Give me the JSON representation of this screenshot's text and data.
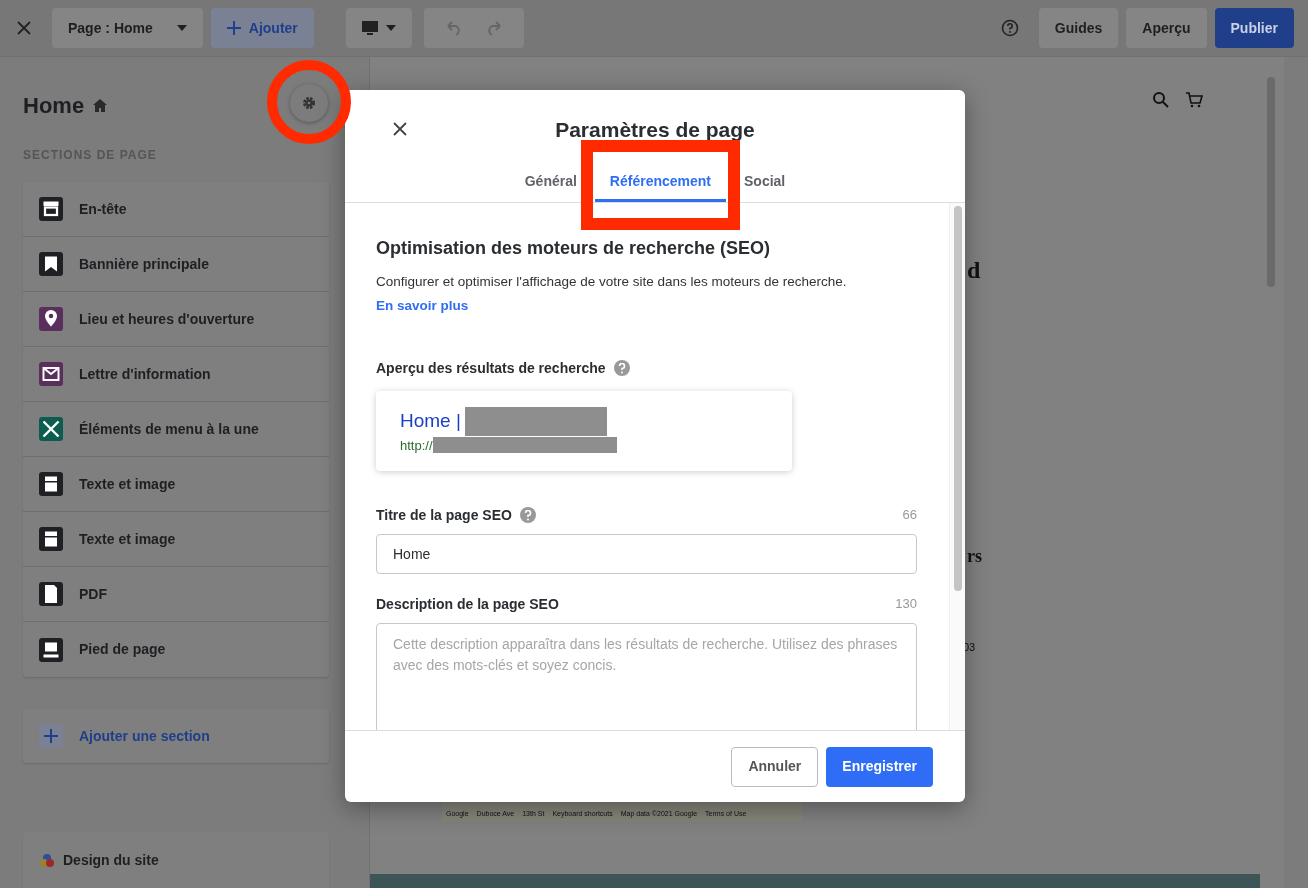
{
  "topbar": {
    "page_select": "Page : Home",
    "add": "Ajouter",
    "buttons": [
      {
        "label": "Guides",
        "kind": "plain"
      },
      {
        "label": "Aperçu",
        "kind": "plain"
      },
      {
        "label": "Publier",
        "kind": "primary"
      }
    ]
  },
  "sidebar": {
    "title": "Home",
    "heading": "SECTIONS DE PAGE",
    "sections": [
      {
        "label": "En-tête",
        "kind": "header",
        "color": "#1e2024"
      },
      {
        "label": "Bannière principale",
        "kind": "banner",
        "color": "#1e2024"
      },
      {
        "label": "Lieu et heures d'ouverture",
        "kind": "location",
        "color": "#5b2f5b"
      },
      {
        "label": "Lettre d'information",
        "kind": "mail",
        "color": "#5b2f5b"
      },
      {
        "label": "Éléments de menu à la une",
        "kind": "menu",
        "color": "#0c5d4f"
      },
      {
        "label": "Texte et image",
        "kind": "block",
        "color": "#1e2024"
      },
      {
        "label": "Texte et image",
        "kind": "block",
        "color": "#1e2024"
      },
      {
        "label": "PDF",
        "kind": "pdf",
        "color": "#1e2024"
      },
      {
        "label": "Pied de page",
        "kind": "footer",
        "color": "#1e2024"
      }
    ],
    "add_section": "Ajouter une section",
    "design": "Design du site"
  },
  "preview": {
    "fragments": [
      "d",
      "rs",
      "03"
    ],
    "map_texts": [
      "Google",
      "Duboce Ave",
      "13th St",
      "Keyboard shortcuts",
      "Map data ©2021 Google",
      "Terms of Use"
    ]
  },
  "modal": {
    "title": "Paramètres de page",
    "tabs": [
      {
        "label": "Général",
        "selected": false
      },
      {
        "label": "Référencement",
        "selected": true
      },
      {
        "label": "Social",
        "selected": false
      }
    ],
    "heading": "Optimisation des moteurs de recherche (SEO)",
    "description": "Configurer et optimiser l'affichage de votre site dans les moteurs de recherche.",
    "link": "En savoir plus",
    "preview_label": "Aperçu des résultats de recherche",
    "result": {
      "title": "Home |",
      "url": "http://"
    },
    "fields": [
      {
        "kind": "input",
        "label": "Titre de la page SEO",
        "help": true,
        "counter": "66",
        "value": "Home"
      },
      {
        "kind": "textarea",
        "label": "Description de la page SEO",
        "help": false,
        "counter": "130",
        "placeholder": "Cette description apparaîtra dans les résultats de recherche. Utilisez des phrases avec des mots-clés et soyez concis."
      }
    ],
    "cancel": "Annuler",
    "save": "Enregistrer"
  }
}
